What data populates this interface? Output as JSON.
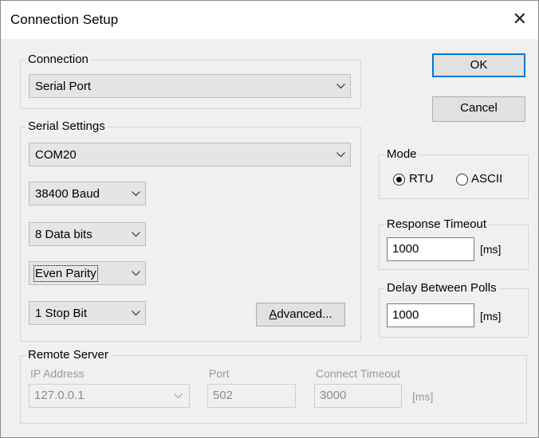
{
  "window": {
    "title": "Connection Setup"
  },
  "connection": {
    "group_label": "Connection",
    "type_selected": "Serial Port"
  },
  "serial": {
    "group_label": "Serial Settings",
    "port": "COM20",
    "baud": "38400 Baud",
    "data_bits": "8 Data bits",
    "parity": "Even Parity",
    "stop_bits": "1 Stop Bit",
    "advanced_label": "Advanced..."
  },
  "buttons": {
    "ok": "OK",
    "cancel": "Cancel"
  },
  "mode": {
    "group_label": "Mode",
    "options": [
      "RTU",
      "ASCII"
    ],
    "selected": "RTU"
  },
  "response_timeout": {
    "group_label": "Response Timeout",
    "value": "1000",
    "unit": "[ms]"
  },
  "delay_between_polls": {
    "group_label": "Delay Between Polls",
    "value": "1000",
    "unit": "[ms]"
  },
  "remote_server": {
    "group_label": "Remote Server",
    "ip_label": "IP Address",
    "ip_value": "127.0.0.1",
    "port_label": "Port",
    "port_value": "502",
    "connect_timeout_label": "Connect Timeout",
    "connect_timeout_value": "3000",
    "unit": "[ms]"
  },
  "icons": {
    "close": "close-icon",
    "dropdown": "chevron-down-icon"
  },
  "colors": {
    "accent": "#0078d7",
    "disabled_text": "#9a9a9a"
  }
}
